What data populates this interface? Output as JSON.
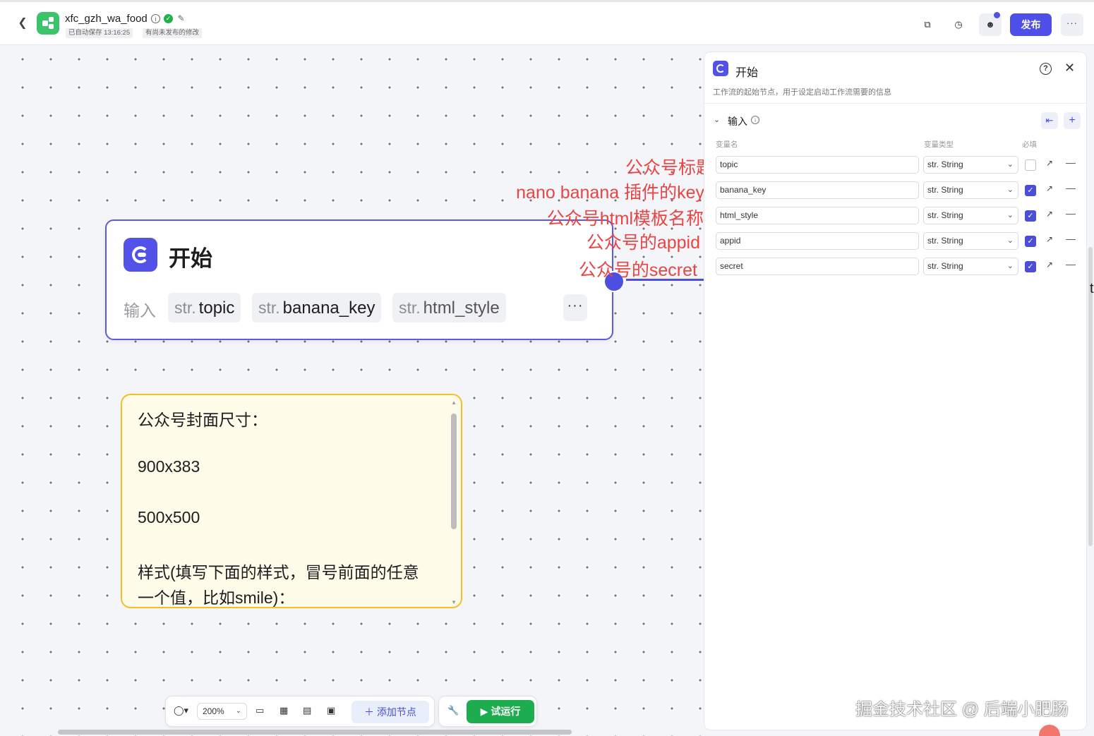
{
  "header": {
    "back_icon": "chevron-left-icon",
    "app_title": "xfc_gzh_wa_food",
    "autosave": "已自动保存 13:16:25",
    "unpublished": "有尚未发布的修改",
    "publish_label": "发布",
    "accent_color": "#4e4ee8"
  },
  "node": {
    "title": "开始",
    "input_label": "输入",
    "chips": [
      {
        "prefix": "str.",
        "name": "topic"
      },
      {
        "prefix": "str.",
        "name": "banana_key"
      },
      {
        "prefix": "str.",
        "name": "html_style"
      }
    ],
    "more_label": "···"
  },
  "note": {
    "lines": [
      "公众号封面尺寸：",
      "900x383",
      "500x500",
      "样式(填写下面的样式，冒号前面的任意",
      "一个值，比如smile)："
    ]
  },
  "annotations": [
    "公众号标题",
    "nano banana 插件的key",
    "公众号html模板名称",
    "公众号的appid",
    "公众号的secret"
  ],
  "bottom_toolbar": {
    "zoom": "200%",
    "add_node": "添加节点",
    "run": "试运行"
  },
  "panel": {
    "title": "开始",
    "description": "工作流的起始节点，用于设定启动工作流需要的信息",
    "section_title": "输入",
    "columns": {
      "name": "变量名",
      "type": "变量类型",
      "required": "必填"
    },
    "rows": [
      {
        "name": "topic",
        "type": "str. String",
        "required": false
      },
      {
        "name": "banana_key",
        "type": "str. String",
        "required": true
      },
      {
        "name": "html_style",
        "type": "str. String",
        "required": true
      },
      {
        "name": "appid",
        "type": "str. String",
        "required": true
      },
      {
        "name": "secret",
        "type": "str. String",
        "required": true
      }
    ]
  },
  "edge_text": "t",
  "watermark": "掘金技术社区 @ 后端小肥肠"
}
